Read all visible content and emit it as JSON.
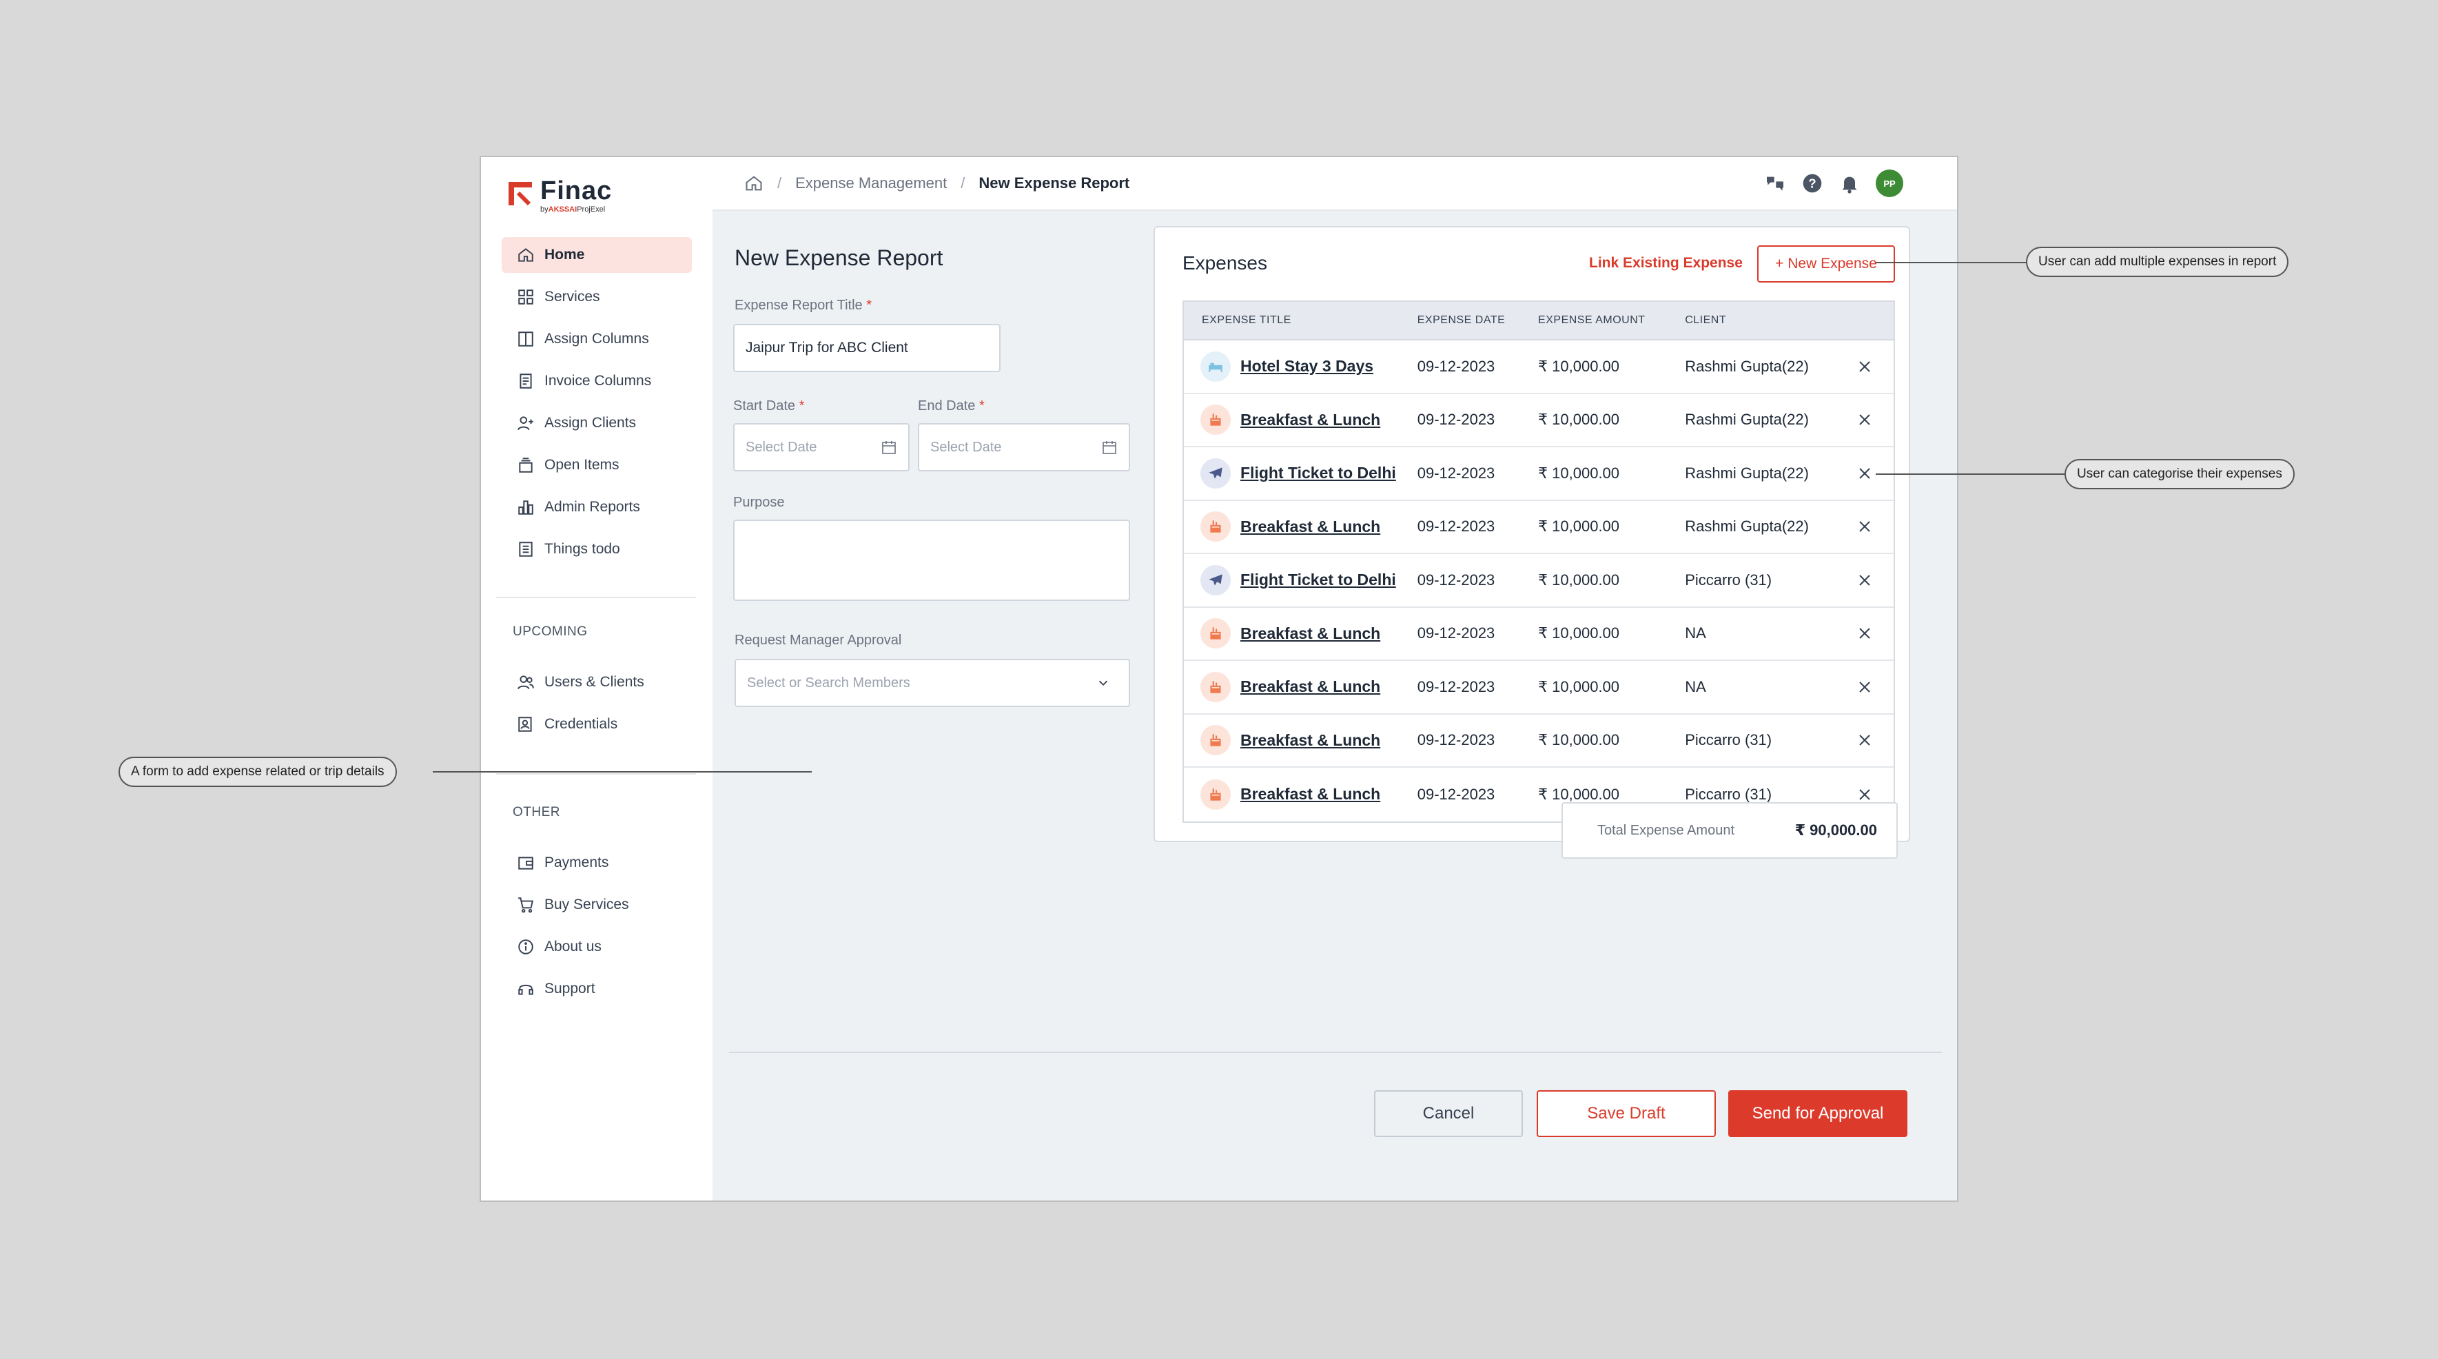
{
  "app": {
    "name": "Finac",
    "sub_by": "by",
    "sub_brand": "AKSSAI",
    "sub_product": "ProjExel"
  },
  "sidebar": {
    "items": [
      {
        "label": "Home",
        "icon": "home-icon",
        "active": true
      },
      {
        "label": "Services",
        "icon": "grid-icon"
      },
      {
        "label": "Assign Columns",
        "icon": "columns-icon"
      },
      {
        "label": "Invoice Columns",
        "icon": "invoice-icon"
      },
      {
        "label": "Assign Clients",
        "icon": "user-plus-icon"
      },
      {
        "label": "Open Items",
        "icon": "stack-icon"
      },
      {
        "label": "Admin Reports",
        "icon": "bar-chart-icon"
      },
      {
        "label": "Things todo",
        "icon": "checklist-icon"
      }
    ],
    "upcoming_label": "UPCOMING",
    "upcoming": [
      {
        "label": "Users & Clients",
        "icon": "users-icon"
      },
      {
        "label": "Credentials",
        "icon": "credentials-icon"
      }
    ],
    "other_label": "OTHER",
    "other": [
      {
        "label": "Payments",
        "icon": "wallet-icon"
      },
      {
        "label": "Buy Services",
        "icon": "cart-icon"
      },
      {
        "label": "About us",
        "icon": "info-icon"
      },
      {
        "label": "Support",
        "icon": "headset-icon"
      }
    ]
  },
  "breadcrumb": {
    "items": [
      "Expense Management",
      "New Expense Report"
    ]
  },
  "header": {
    "avatar_initials": "PP"
  },
  "form": {
    "title": "New Expense Report",
    "report_title_label": "Expense Report Title",
    "report_title_value": "Jaipur Trip for ABC Client",
    "start_date_label": "Start Date",
    "start_date_placeholder": "Select Date",
    "end_date_label": "End Date",
    "end_date_placeholder": "Select Date",
    "purpose_label": "Purpose",
    "purpose_value": "",
    "approval_label": "Request Manager Approval",
    "approval_placeholder": "Select or Search Members",
    "required_mark": "*"
  },
  "expenses": {
    "title": "Expenses",
    "link_existing_label": "Link Existing Expense",
    "new_expense_label": "+ New Expense",
    "columns": [
      "EXPENSE TITLE",
      "EXPENSE DATE",
      "EXPENSE AMOUNT",
      "CLIENT"
    ],
    "rows": [
      {
        "category": "hotel",
        "title": "Hotel Stay 3 Days",
        "date": "09-12-2023",
        "amount": "₹ 10,000.00",
        "client": "Rashmi Gupta(22)"
      },
      {
        "category": "food",
        "title": "Breakfast & Lunch",
        "date": "09-12-2023",
        "amount": "₹ 10,000.00",
        "client": "Rashmi Gupta(22)"
      },
      {
        "category": "flight",
        "title": "Flight Ticket to Delhi",
        "date": "09-12-2023",
        "amount": "₹ 10,000.00",
        "client": "Rashmi Gupta(22)"
      },
      {
        "category": "food",
        "title": "Breakfast & Lunch",
        "date": "09-12-2023",
        "amount": "₹ 10,000.00",
        "client": "Rashmi Gupta(22)"
      },
      {
        "category": "flight",
        "title": "Flight Ticket to Delhi",
        "date": "09-12-2023",
        "amount": "₹ 10,000.00",
        "client": "Piccarro (31)"
      },
      {
        "category": "food",
        "title": "Breakfast & Lunch",
        "date": "09-12-2023",
        "amount": "₹ 10,000.00",
        "client": "NA"
      },
      {
        "category": "food",
        "title": "Breakfast & Lunch",
        "date": "09-12-2023",
        "amount": "₹ 10,000.00",
        "client": "NA"
      },
      {
        "category": "food",
        "title": "Breakfast & Lunch",
        "date": "09-12-2023",
        "amount": "₹ 10,000.00",
        "client": "Piccarro (31)"
      },
      {
        "category": "food",
        "title": "Breakfast & Lunch",
        "date": "09-12-2023",
        "amount": "₹ 10,000.00",
        "client": "Piccarro (31)"
      }
    ],
    "total_label": "Total Expense Amount",
    "total_value": "₹ 90,000.00"
  },
  "actions": {
    "cancel_label": "Cancel",
    "save_draft_label": "Save Draft",
    "send_label": "Send for Approval"
  },
  "annotations": {
    "multiple_expenses": "User can add multiple expenses in report",
    "categorise": "User can categorise their expenses",
    "form_note": "A form to add expense related or trip details"
  },
  "colors": {
    "accent": "#d93b2b",
    "active_nav_bg": "#fde3df",
    "avatar": "#3d8b35",
    "flight_icon_bg": "#e3e7f4",
    "food_icon_bg": "#fde4db",
    "hotel_icon_bg": "#e4f1f8"
  }
}
